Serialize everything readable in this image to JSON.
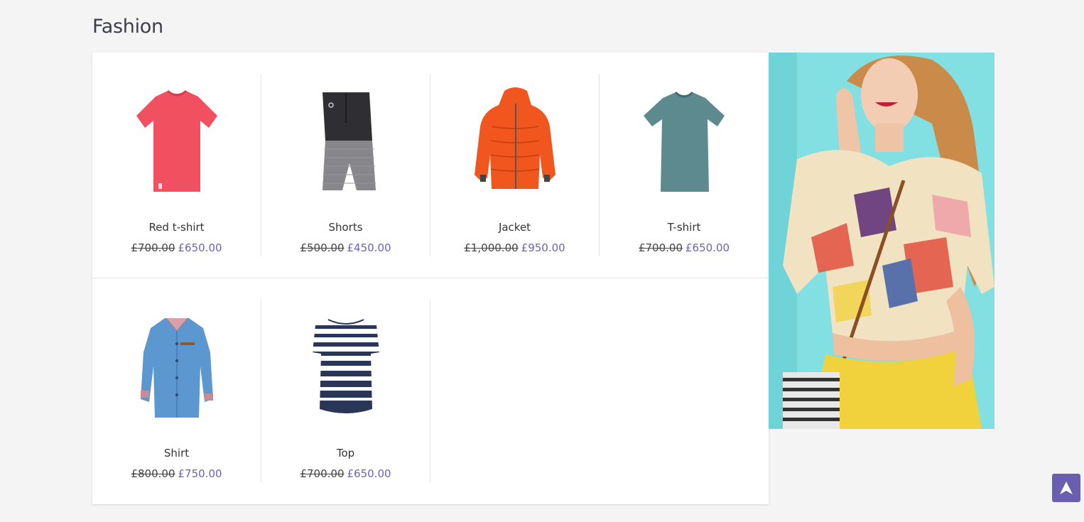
{
  "section": {
    "title": "Fashion"
  },
  "colors": {
    "accent": "#6a5fae",
    "price_new": "#6a63b8",
    "background": "#f5f4f5"
  },
  "products": [
    {
      "name": "Red t-shirt",
      "old_price": "£700.00",
      "price": "£650.00",
      "icon": "red-tshirt-image"
    },
    {
      "name": "Shorts",
      "old_price": "£500.00",
      "price": "£450.00",
      "icon": "shorts-image"
    },
    {
      "name": "Jacket",
      "old_price": "£1,000.00",
      "price": "£950.00",
      "icon": "orange-jacket-image"
    },
    {
      "name": "T-shirt",
      "old_price": "£700.00",
      "price": "£650.00",
      "icon": "teal-tshirt-image"
    },
    {
      "name": "Shirt",
      "old_price": "£800.00",
      "price": "£750.00",
      "icon": "denim-shirt-image"
    },
    {
      "name": "Top",
      "old_price": "£700.00",
      "price": "£650.00",
      "icon": "striped-top-image"
    }
  ],
  "promo": {
    "icon": "fashion-model-image"
  },
  "scroll_top": {
    "icon": "arrow-up-icon"
  }
}
